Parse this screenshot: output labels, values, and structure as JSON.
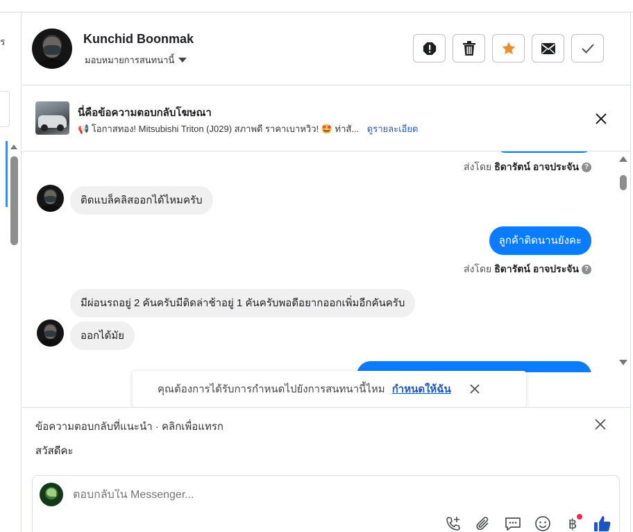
{
  "left_panel": {
    "text_fragment": "ร"
  },
  "header": {
    "name": "Kunchid Boonmak",
    "assign_label": "มอบหมายการสนทนานี้",
    "actions": [
      "spam-icon",
      "trash-icon",
      "star-icon",
      "mail-icon",
      "check-icon"
    ],
    "star_color": "#f28c28"
  },
  "ad_reply": {
    "title": "นี่คือข้อความตอบกลับโฆษณา",
    "description": "📢 โอกาสทอง! Mitsubishi Triton (J029) สภาพดี ราคาเบาหวิว! 🤩 ท่าสั...",
    "details_link": "ดูรายละเอียด"
  },
  "conversation": {
    "sent_by_prefix": "ส่งโดย",
    "sender_name": "ธิดารัตน์ อาจประจัน",
    "messages": [
      {
        "direction": "in",
        "text": "ติดแบล็คลิสออกได้ไหมครับ"
      },
      {
        "direction": "out",
        "text": "ลูกค้าติดนานยังคะ"
      },
      {
        "direction": "in",
        "text": "มีผ่อนรถอยู่ 2 คันครับมีติดล่าช้าอยู่ 1 คันครับพอดีอยากออกเพิ่มอีกคันครับ"
      },
      {
        "direction": "in",
        "text": "ออกได้มัย"
      }
    ],
    "accent_color": "#0a7cff"
  },
  "assign_toast": {
    "text": "คุณต้องการได้รับการกำหนดไปยังการสนทนานี้ไหม",
    "link": "กำหนดให้ฉัน"
  },
  "suggested_replies": {
    "heading": "ข้อความตอบกลับที่แนะนำ · คลิกเพื่อแทรก",
    "items": [
      "สวัสดีคะ"
    ]
  },
  "composer": {
    "placeholder": "ตอบกลับใน Messenger...",
    "tools": [
      "call-add-icon",
      "attachment-icon",
      "saved-reply-icon",
      "emoji-icon",
      "payment-icon",
      "like-icon"
    ],
    "payment_symbol": "฿"
  }
}
